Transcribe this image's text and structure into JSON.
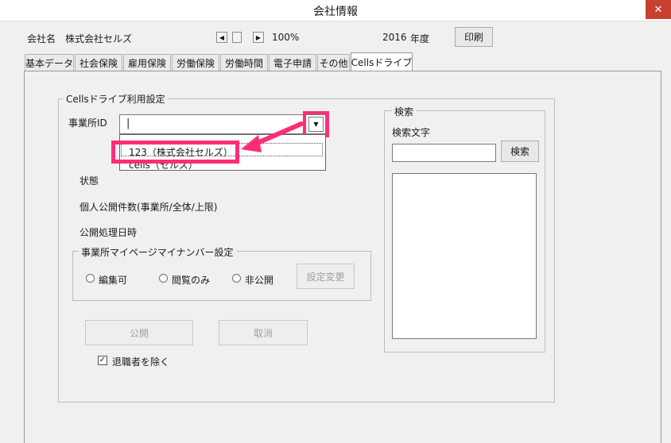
{
  "window": {
    "title": "会社情報",
    "close_label": "✕"
  },
  "header": {
    "company_label": "会社名",
    "company_name": "株式会社セルズ",
    "zoom": "100%",
    "year": "2016",
    "year_unit": "年度",
    "print_label": "印刷"
  },
  "tabs": [
    {
      "label": "基本データ"
    },
    {
      "label": "社会保険"
    },
    {
      "label": "雇用保険"
    },
    {
      "label": "労働保険"
    },
    {
      "label": "労働時間"
    },
    {
      "label": "電子申請"
    },
    {
      "label": "その他"
    },
    {
      "label": "Cellsドライブ"
    }
  ],
  "cells_settings": {
    "title": "Cellsドライブ利用設定",
    "office_id_label": "事業所ID",
    "office_id_value": "|",
    "dropdown_options": [
      "123（株式会社セルズ）",
      "cells（セルズ）"
    ],
    "status_label": "状態",
    "personal_count_label": "個人公開件数(事業所/全体/上限)",
    "publish_date_label": "公開処理日時",
    "mynumber": {
      "title": "事業所マイページマイナンバー設定",
      "radio_editable": "編集可",
      "radio_view_only": "閲覧のみ",
      "radio_private": "非公開",
      "change_button": "設定変更"
    },
    "publish_button": "公開",
    "cancel_button": "取消",
    "exclude_retired_label": "退職者を除く",
    "exclude_retired_checked": "✓"
  },
  "search": {
    "title": "検索",
    "keyword_label": "検索文字",
    "keyword_value": "",
    "search_button": "検索"
  },
  "colors": {
    "highlight": "#ff2d78",
    "panel": "#f0f0f0",
    "tab_active": "#ffffff"
  }
}
